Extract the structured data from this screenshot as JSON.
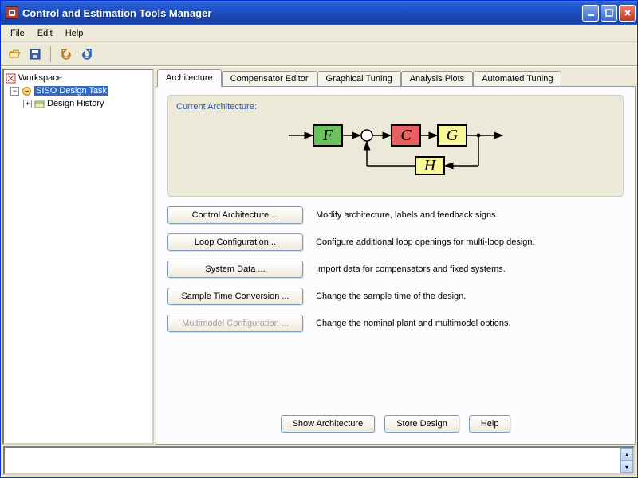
{
  "window": {
    "title": "Control and Estimation Tools Manager"
  },
  "menubar": {
    "file": "File",
    "edit": "Edit",
    "help": "Help"
  },
  "sidebar": {
    "root": "Workspace",
    "task": "SISO Design Task",
    "history": "Design History"
  },
  "tabs": {
    "arch": "Architecture",
    "comp": "Compensator Editor",
    "tune": "Graphical Tuning",
    "plots": "Analysis Plots",
    "auto": "Automated Tuning"
  },
  "arch": {
    "group_title": "Current Architecture:",
    "blocks": {
      "f": "F",
      "c": "C",
      "g": "G",
      "h": "H"
    },
    "btn_control": "Control Architecture ...",
    "desc_control": "Modify architecture, labels and feedback signs.",
    "btn_loop": "Loop Configuration...",
    "desc_loop": "Configure additional loop openings for multi-loop design.",
    "btn_sysdata": "System Data ...",
    "desc_sysdata": "Import data for compensators and fixed systems.",
    "btn_sample": "Sample Time Conversion ...",
    "desc_sample": "Change the sample time of the design.",
    "btn_multi": "Multimodel Configuration ...",
    "desc_multi": "Change the nominal plant and multimodel options."
  },
  "footer": {
    "show": "Show Architecture",
    "store": "Store Design",
    "help": "Help"
  }
}
